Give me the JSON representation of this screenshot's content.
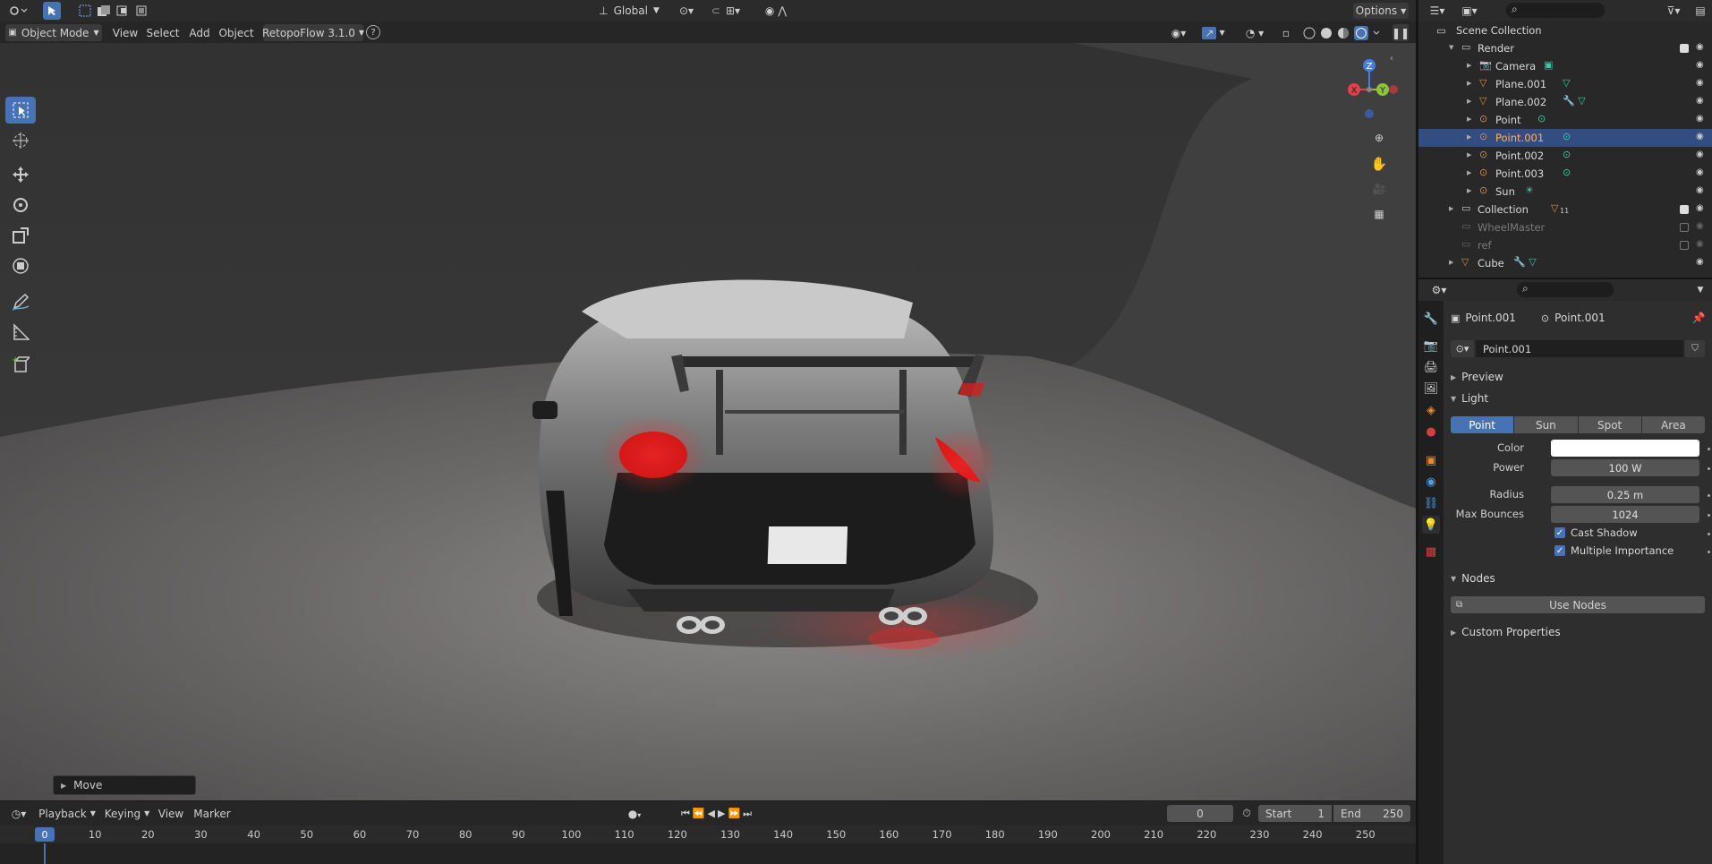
{
  "header": {
    "transform_orientation": "Global",
    "options_label": "Options"
  },
  "viewport_header": {
    "mode": "Object Mode",
    "menus": [
      "View",
      "Select",
      "Add",
      "Object"
    ],
    "addon": "RetopoFlow 3.1.0"
  },
  "viewport": {
    "operator_panel": "Move",
    "gizmo": {
      "x": "X",
      "y": "Y",
      "z": "Z"
    }
  },
  "timeline": {
    "menus": [
      "Playback",
      "Keying",
      "View",
      "Marker"
    ],
    "current_frame": "0",
    "start_label": "Start",
    "start_value": "1",
    "end_label": "End",
    "end_value": "250",
    "playhead": "0",
    "ticks": [
      "10",
      "20",
      "30",
      "40",
      "50",
      "60",
      "70",
      "80",
      "90",
      "100",
      "110",
      "120",
      "130",
      "140",
      "150",
      "160",
      "170",
      "180",
      "190",
      "200",
      "210",
      "220",
      "230",
      "240",
      "250"
    ]
  },
  "outliner": {
    "root": "Scene Collection",
    "rows": [
      {
        "label": "Render",
        "kind": "collection",
        "checked": true
      },
      {
        "label": "Camera",
        "kind": "camera"
      },
      {
        "label": "Plane.001",
        "kind": "mesh"
      },
      {
        "label": "Plane.002",
        "kind": "mesh"
      },
      {
        "label": "Point",
        "kind": "light"
      },
      {
        "label": "Point.001",
        "kind": "light",
        "selected": true
      },
      {
        "label": "Point.002",
        "kind": "light"
      },
      {
        "label": "Point.003",
        "kind": "light"
      },
      {
        "label": "Sun",
        "kind": "light"
      },
      {
        "label": "Collection",
        "kind": "collection",
        "checked": true
      },
      {
        "label": "WheelMaster",
        "kind": "collection",
        "excluded": true
      },
      {
        "label": "ref",
        "kind": "collection",
        "excluded": true
      },
      {
        "label": "Cube",
        "kind": "mesh"
      }
    ],
    "collection_badge": "11"
  },
  "properties": {
    "breadcrumb_object": "Point.001",
    "breadcrumb_data": "Point.001",
    "datablock_name": "Point.001",
    "sections": {
      "preview": "Preview",
      "light": "Light",
      "nodes": "Nodes",
      "custom": "Custom Properties"
    },
    "light_types": [
      "Point",
      "Sun",
      "Spot",
      "Area"
    ],
    "active_light_type": "Point",
    "color_label": "Color",
    "color_value": "#ffffff",
    "power_label": "Power",
    "power_value": "100 W",
    "radius_label": "Radius",
    "radius_value": "0.25 m",
    "bounces_label": "Max Bounces",
    "bounces_value": "1024",
    "cast_shadow": "Cast Shadow",
    "multiple_importance": "Multiple Importance",
    "use_nodes": "Use Nodes"
  },
  "colors": {
    "accent": "#4772b3",
    "selected_row": "#334d80",
    "light_icon": "#e08a3a",
    "data_icon": "#3dc9a6"
  }
}
